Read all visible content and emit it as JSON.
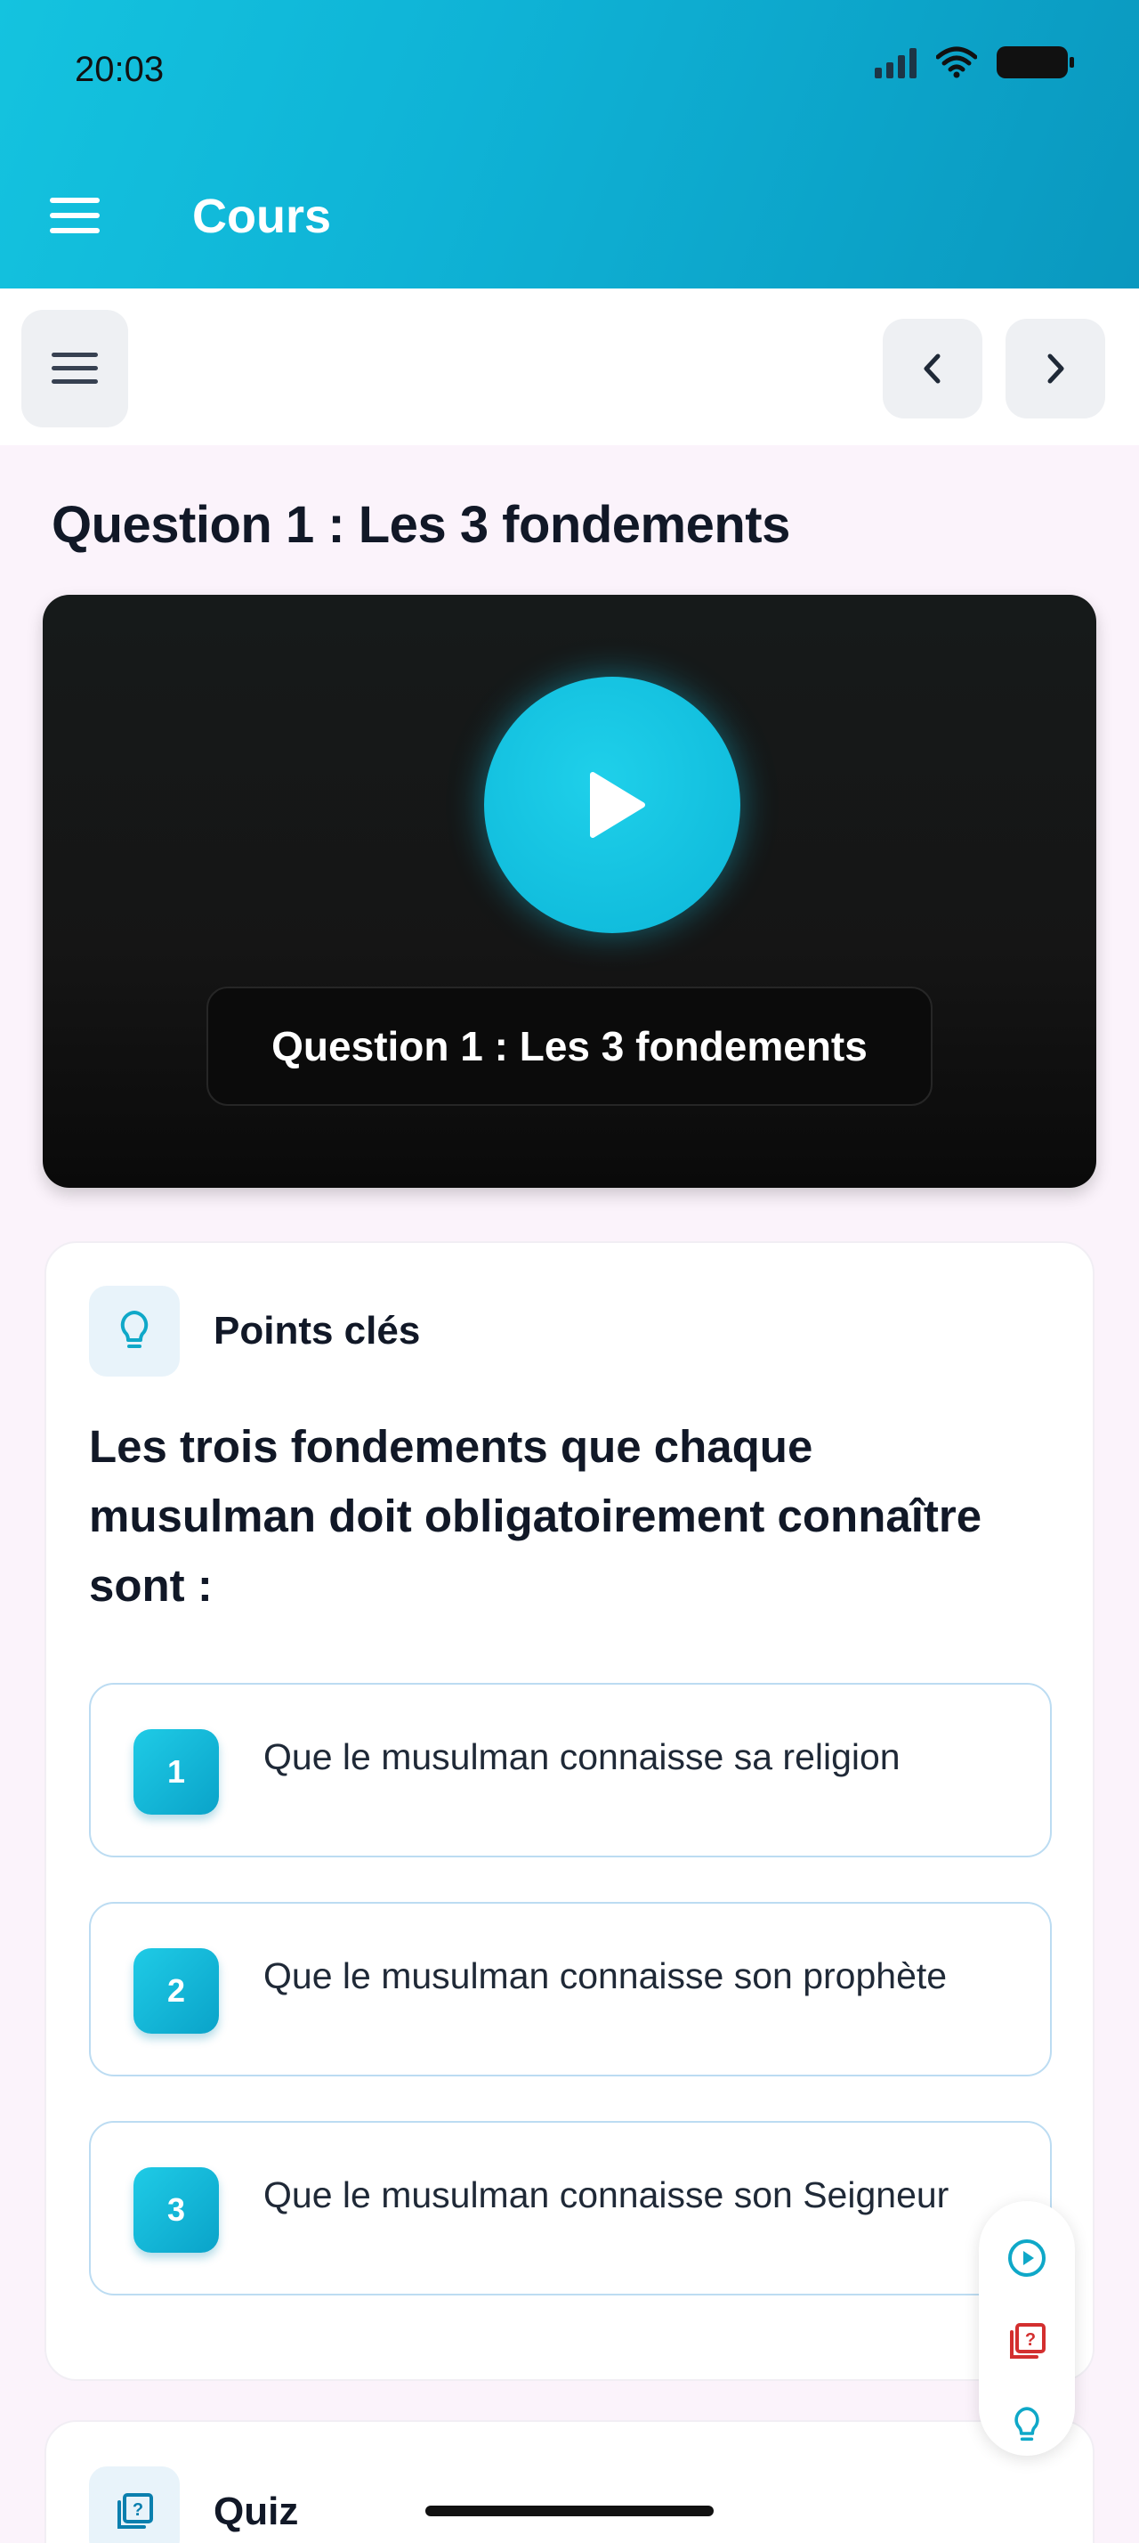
{
  "status_bar": {
    "time": "20:03"
  },
  "header": {
    "title": "Cours"
  },
  "page": {
    "title": "Question 1 : Les 3 fondements"
  },
  "video": {
    "caption": "Question 1 : Les 3 fondements"
  },
  "key_points": {
    "label": "Points clés",
    "intro": "Les trois fondements que chaque musulman doit obligatoirement connaître sont :",
    "items": [
      {
        "number": "1",
        "text": "Que le musulman connaisse sa religion"
      },
      {
        "number": "2",
        "text": "Que le musulman connaisse son prophète"
      },
      {
        "number": "3",
        "text": "Que le musulman connaisse son Seigneur"
      }
    ]
  },
  "quiz": {
    "label": "Quiz"
  },
  "colors": {
    "accent": "#0fb3d6",
    "quiz_icon": "#d32f2f",
    "text": "#111827"
  },
  "icons": [
    "menu-icon",
    "chevron-left-icon",
    "chevron-right-icon",
    "play-icon",
    "lightbulb-icon",
    "quiz-icon",
    "play-circle-icon"
  ]
}
